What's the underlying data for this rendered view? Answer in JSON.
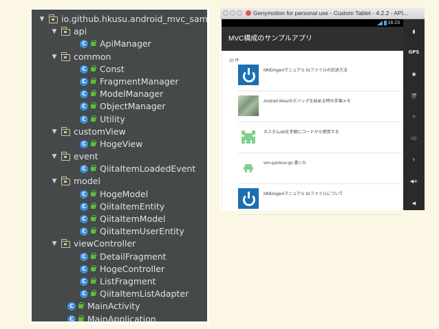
{
  "tree": [
    {
      "type": "folder",
      "depth": 0,
      "label": "io.github.hkusu.android_mvc_sample"
    },
    {
      "type": "folder",
      "depth": 1,
      "label": "api"
    },
    {
      "type": "class",
      "depth": 3,
      "label": "ApiManager"
    },
    {
      "type": "folder",
      "depth": 1,
      "label": "common"
    },
    {
      "type": "class",
      "depth": 3,
      "label": "Const"
    },
    {
      "type": "class",
      "depth": 3,
      "label": "FragmentManager"
    },
    {
      "type": "class",
      "depth": 3,
      "label": "ModelManager"
    },
    {
      "type": "class",
      "depth": 3,
      "label": "ObjectManager"
    },
    {
      "type": "class",
      "depth": 3,
      "label": "Utility"
    },
    {
      "type": "folder",
      "depth": 1,
      "label": "customView"
    },
    {
      "type": "class",
      "depth": 3,
      "label": "HogeView"
    },
    {
      "type": "folder",
      "depth": 1,
      "label": "event"
    },
    {
      "type": "class",
      "depth": 3,
      "label": "QiitaItemLoadedEvent"
    },
    {
      "type": "folder",
      "depth": 1,
      "label": "model"
    },
    {
      "type": "class",
      "depth": 3,
      "label": "HogeModel"
    },
    {
      "type": "class",
      "depth": 3,
      "label": "QiitaItemEntity"
    },
    {
      "type": "class",
      "depth": 3,
      "label": "QiitaItemModel"
    },
    {
      "type": "class",
      "depth": 3,
      "label": "QiitaItemUserEntity"
    },
    {
      "type": "folder",
      "depth": 1,
      "label": "viewController"
    },
    {
      "type": "class",
      "depth": 3,
      "label": "DetailFragment"
    },
    {
      "type": "class",
      "depth": 3,
      "label": "HogeController"
    },
    {
      "type": "class",
      "depth": 3,
      "label": "ListFragment"
    },
    {
      "type": "class",
      "depth": 3,
      "label": "QiitaItemListAdapter"
    },
    {
      "type": "class",
      "depth": 2,
      "label": "MainActivity"
    },
    {
      "type": "class",
      "depth": 2,
      "label": "MainApplication"
    }
  ],
  "emulator": {
    "window_title": "Genymotion for personal use - Custom Tablet - 4.2.2 - API...",
    "status_time": "16:23",
    "app_title": "MVC構成のサンプルアプリ",
    "count_label": "20 件",
    "items": [
      {
        "thumb": "power",
        "text": "MMDAgentマニュアル fstファイルの記述方法"
      },
      {
        "thumb": "photo",
        "text": "Android Wearのデバッグを始める時の手順メモ"
      },
      {
        "thumb": "invader-big",
        "text": "カスタムxibを手軽にコードから使用する"
      },
      {
        "thumb": "invader-small",
        "text": "vim-quickrun-go 書いた"
      },
      {
        "thumb": "power",
        "text": "MMDAgentマニュアル fstファイルについて"
      }
    ],
    "sidebar_icons": [
      {
        "name": "battery-icon",
        "label": "▮",
        "dim": false
      },
      {
        "name": "gps-icon",
        "label": "GPS",
        "dim": false
      },
      {
        "name": "webcam-icon",
        "label": "◉",
        "dim": false
      },
      {
        "name": "video-icon",
        "label": "🎬",
        "dim": true
      },
      {
        "name": "dpad-icon",
        "label": "✥",
        "dim": true
      },
      {
        "name": "id-icon",
        "label": "ID",
        "dim": true
      },
      {
        "name": "network-icon",
        "label": "◗",
        "dim": true
      },
      {
        "name": "volume-up-icon",
        "label": "◀+",
        "dim": false
      },
      {
        "name": "volume-down-icon",
        "label": "◀",
        "dim": false
      }
    ]
  }
}
